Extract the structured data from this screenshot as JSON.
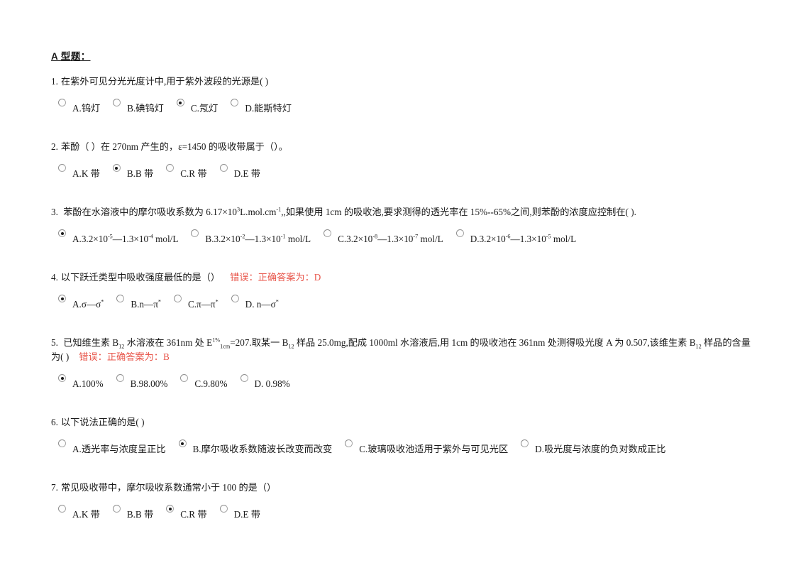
{
  "document": {
    "section_title": "A 型题：",
    "feedback_color": "#e8554a"
  },
  "questions": [
    {
      "number": "1.",
      "stem": "在紫外可见分光光度计中,用于紫外波段的光源是( )",
      "feedback": "",
      "options": [
        {
          "label": "A.钨灯",
          "selected": false
        },
        {
          "label": "B.碘钨灯",
          "selected": false
        },
        {
          "label": "C.氖灯",
          "selected": true
        },
        {
          "label": "D.能斯特灯",
          "selected": false
        }
      ]
    },
    {
      "number": "2.",
      "stem": "苯酚（ ）在 270nm 产生的，ε=1450 的吸收带属于（）。",
      "feedback": "",
      "options": [
        {
          "label": "A.K 带",
          "selected": false
        },
        {
          "label": "B.B 带",
          "selected": true
        },
        {
          "label": "C.R 带",
          "selected": false
        },
        {
          "label": "D.E 带",
          "selected": false
        }
      ]
    },
    {
      "number": "3.",
      "stem_html": "苯酚在水溶液中的摩尔吸收系数为 6.17×10<sup>3</sup>L.mol.cm<sup>-1</sup>,,如果使用 1cm 的吸收池,要求测得的透光率在 15%--65%之间,则苯酚的浓度应控制在( ).",
      "feedback": "",
      "options": [
        {
          "label_html": "A.3.2×10<sup>-5</sup>—1.3×10<sup>-4</sup> mol/L",
          "selected": true
        },
        {
          "label_html": "B.3.2×10<sup>-2</sup>—1.3×10<sup>-1</sup> mol/L",
          "selected": false
        },
        {
          "label_html": "C.3.2×10<sup>-8</sup>—1.3×10<sup>-7</sup> mol/L",
          "selected": false
        },
        {
          "label_html": "D.3.2×10<sup>-6</sup>—1.3×10<sup>-5</sup> mol/L",
          "selected": false
        }
      ]
    },
    {
      "number": "4.",
      "stem": "以下跃迁类型中吸收强度最低的是（）",
      "feedback": "错误：正确答案为：D",
      "options": [
        {
          "label_html": "A.σ—σ<sup>*</sup>",
          "selected": true
        },
        {
          "label_html": "B.n—π<sup>*</sup>",
          "selected": false
        },
        {
          "label_html": "C.π—π<sup>*</sup>",
          "selected": false
        },
        {
          "label_html": "D. n—σ<sup>*</sup>",
          "selected": false
        }
      ]
    },
    {
      "number": "5.",
      "stem_html": "已知维生素 B<sub>12</sub> 水溶液在 361nm 处 E<sup>1%</sup><sub>1cm</sub>=207.取某一 B<sub>12</sub> 样品 25.0mg,配成 1000ml 水溶液后,用 1cm 的吸收池在 361nm 处测得吸光度 A 为 0.507,该维生素 B<sub>12</sub> 样品的含量为( )",
      "feedback": "错误：正确答案为：B",
      "options": [
        {
          "label": "A.100%",
          "selected": true
        },
        {
          "label": "B.98.00%",
          "selected": false
        },
        {
          "label": "C.9.80%",
          "selected": false
        },
        {
          "label": "D. 0.98%",
          "selected": false
        }
      ]
    },
    {
      "number": "6.",
      "stem": "以下说法正确的是( )",
      "feedback": "",
      "options": [
        {
          "label": "A.透光率与浓度呈正比",
          "selected": false
        },
        {
          "label": "B.摩尔吸收系数随波长改变而改变",
          "selected": true
        },
        {
          "label": "C.玻璃吸收池适用于紫外与可见光区",
          "selected": false
        },
        {
          "label": "D.吸光度与浓度的负对数成正比",
          "selected": false
        }
      ]
    },
    {
      "number": "7.",
      "stem": "常见吸收带中，摩尔吸收系数通常小于 100 的是（）",
      "feedback": "",
      "options": [
        {
          "label": "A.K 带",
          "selected": false
        },
        {
          "label": "B.B 带",
          "selected": false
        },
        {
          "label": "C.R 带",
          "selected": true
        },
        {
          "label": "D.E 带",
          "selected": false
        }
      ]
    }
  ]
}
